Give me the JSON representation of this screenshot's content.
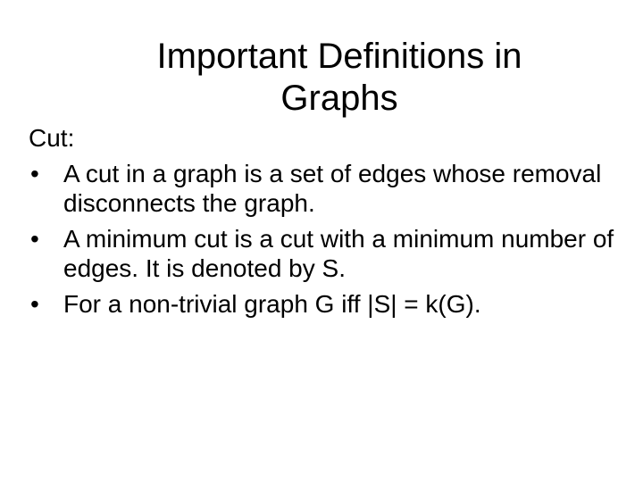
{
  "slide": {
    "title": "Important Definitions in Graphs",
    "section_heading": "Cut:",
    "bullet_glyph": "•",
    "bullets": [
      "A cut in a graph is a set of edges whose removal disconnects the graph.",
      "A minimum cut is a cut with a minimum number of edges. It is denoted by S.",
      "For a non-trivial graph G iff |S| = k(G)."
    ]
  }
}
